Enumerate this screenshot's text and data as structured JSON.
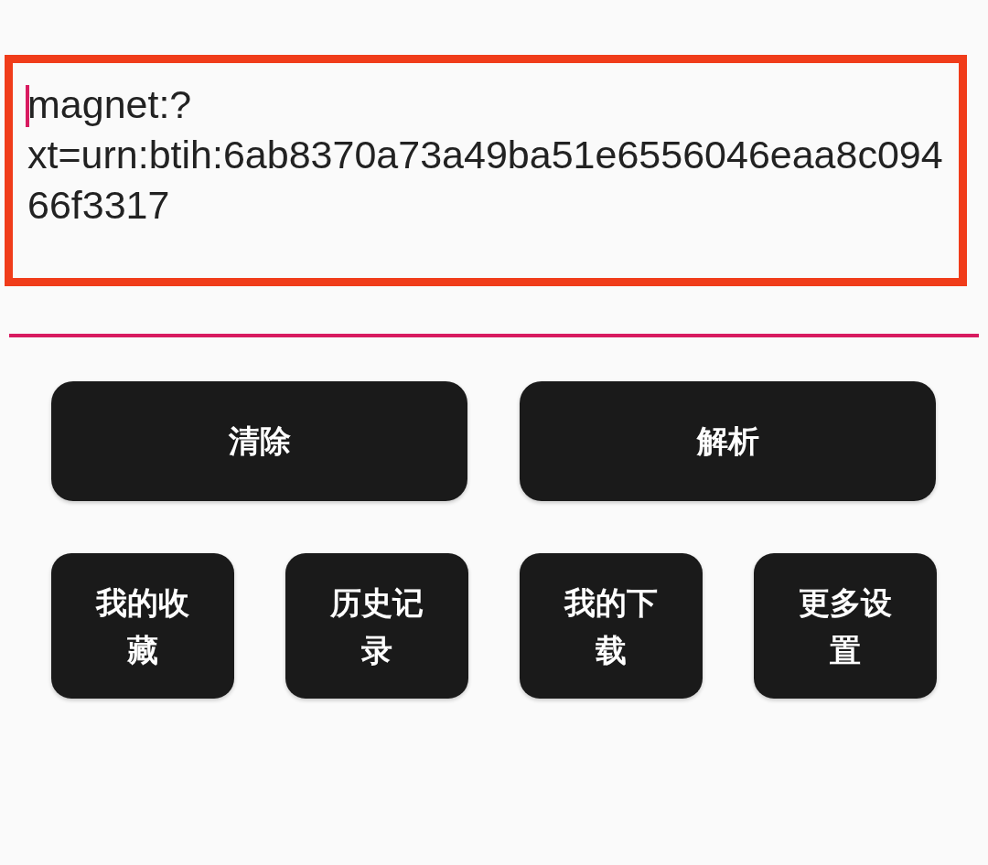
{
  "input": {
    "value": "magnet:?xt=urn:btih:6ab8370a73a49ba51e6556046eaa8c09466f3317"
  },
  "primary_buttons": [
    "清除",
    "解析"
  ],
  "secondary_buttons": [
    "我的收藏",
    "历史记录",
    "我的下载",
    "更多设置"
  ]
}
